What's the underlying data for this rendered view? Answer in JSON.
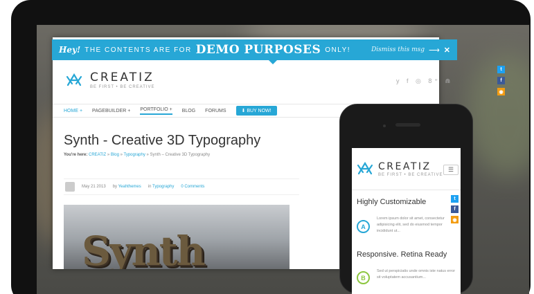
{
  "topbar": {
    "hey": "Hey!",
    "part1": "THE CONTENTS ARE FOR",
    "highlight": "DEMO PURPOSES",
    "part2": "ONLY!",
    "dismiss": "Dismiss this msg",
    "arrow": "⟶",
    "close": "✕"
  },
  "brand": {
    "name": "CREATIZ",
    "tagline": "BE FIRST • BE CREATIVE"
  },
  "social_top": "y f ◎ 8⁺ ⋒",
  "nav": {
    "items": [
      "HOME +",
      "PAGEBUILDER +",
      "PORTFOLIO +",
      "BLOG",
      "FORUMS"
    ],
    "buy": "⬇ BUY NOW!"
  },
  "post": {
    "title": "Synth - Creative 3D Typography",
    "breadcrumb_label": "You're here:",
    "breadcrumb": [
      "CREATIZ",
      "Blog",
      "Typography",
      "Synth – Creative 3D Typography"
    ],
    "date": "May 21 2013",
    "by_label": "by",
    "author": "Yeahthemes",
    "in_label": "in",
    "category": "Typography",
    "comments": "0 Comments",
    "image_text": "Synth"
  },
  "side_social": [
    {
      "icon": "twitter-icon",
      "glyph": "t",
      "color": "#1da1f2"
    },
    {
      "icon": "facebook-icon",
      "glyph": "f",
      "color": "#3b5998"
    },
    {
      "icon": "rss-icon",
      "glyph": "◉",
      "color": "#f39c12"
    }
  ],
  "phone": {
    "menu": "☰",
    "feature_a": {
      "title": "Highly Customizable",
      "letter": "A",
      "color": "#27a7d6",
      "text": "Lorem ipsum dolor sit amet, consectetur adipisicing elit, sed do eiusmod tempor incididunt ut..."
    },
    "feature_b": {
      "title": "Responsive. Retina Ready",
      "letter": "B",
      "color": "#8cc63f",
      "text": "Sed ut perspiciatis unde omnis iste natus error sit voluptatem accusantium..."
    }
  },
  "colors": {
    "accent": "#27a7d6"
  }
}
